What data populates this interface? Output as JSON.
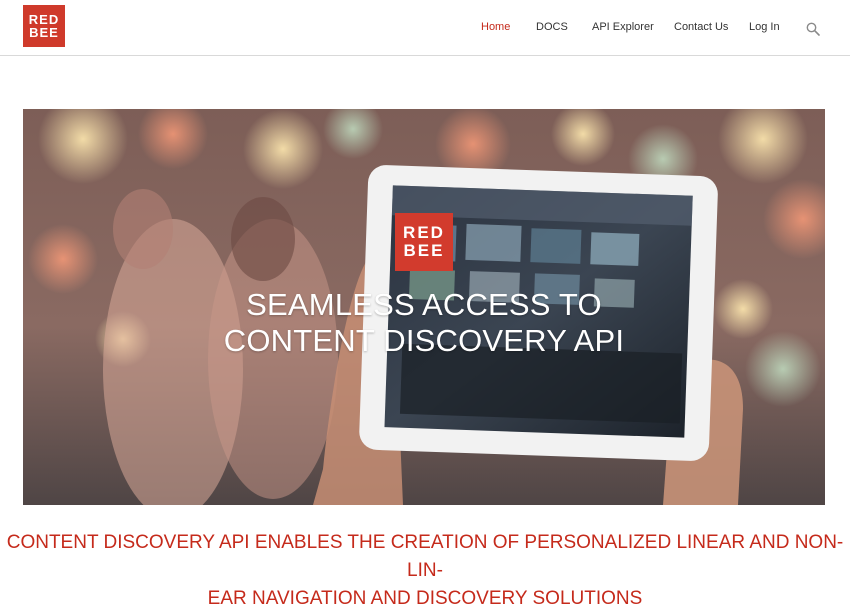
{
  "brand": {
    "logo_line1": "RED",
    "logo_line2": "BEE",
    "accent": "#cf3a2b"
  },
  "nav": {
    "items": [
      {
        "label": "Home",
        "active": true
      },
      {
        "label": "DOCS",
        "active": false
      },
      {
        "label": "API Explorer",
        "active": false
      },
      {
        "label": "Contact Us",
        "active": false
      },
      {
        "label": "Log In",
        "active": false
      }
    ],
    "search_icon": "search-icon"
  },
  "hero": {
    "logo_line1": "RED",
    "logo_line2": "BEE",
    "title_line1": "SEAMLESS ACCESS TO",
    "title_line2": "CONTENT DISCOVERY API"
  },
  "tagline": {
    "line1": "CONTENT DISCOVERY API ENABLES THE CREATION OF PERSONALIZED LINEAR AND NON-LIN-",
    "line2": "EAR NAVIGATION AND DISCOVERY SOLUTIONS"
  }
}
